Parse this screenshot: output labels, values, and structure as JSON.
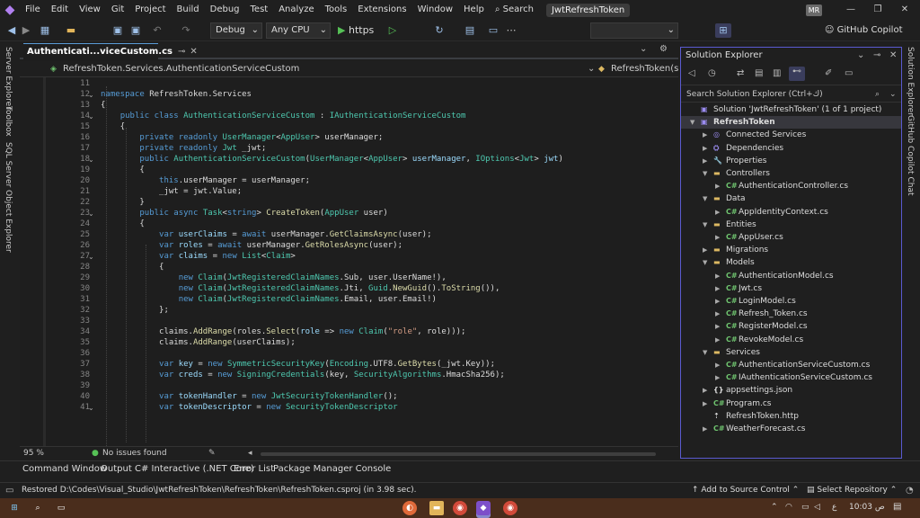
{
  "menubar": {
    "items": [
      "File",
      "Edit",
      "View",
      "Git",
      "Project",
      "Build",
      "Debug",
      "Test",
      "Analyze",
      "Tools",
      "Extensions",
      "Window",
      "Help"
    ],
    "search_label": "Search",
    "solution_title": "JwtRefreshToken",
    "avatar_initials": "MR"
  },
  "toolbar": {
    "config": "Debug",
    "platform": "Any CPU",
    "run_label": "https",
    "copilot_label": "GitHub Copilot"
  },
  "left_tabs": [
    "Server Explorer",
    "Toolbox",
    "SQL Server Object Explorer"
  ],
  "right_tabs": [
    "Solution Explorer",
    "GitHub Copilot Chat"
  ],
  "editor": {
    "tab_title": "Authenticati...viceCustom.cs",
    "nav_left": "RefreshToken.Services.AuthenticationServiceCustom",
    "nav_right": "RefreshToken(strin",
    "zoom": "95 %",
    "issues": "No issues found",
    "lines": [
      {
        "n": "11",
        "t": []
      },
      {
        "n": "12",
        "f": true,
        "t": [
          [
            "kw",
            "namespace "
          ],
          [
            "",
            "RefreshToken.Services"
          ]
        ]
      },
      {
        "n": "13",
        "t": [
          [
            "",
            "{"
          ]
        ]
      },
      {
        "n": "14",
        "f": true,
        "t": [
          [
            "",
            "    "
          ],
          [
            "kw",
            "public class "
          ],
          [
            "ty",
            "AuthenticationServiceCustom"
          ],
          [
            "",
            " : "
          ],
          [
            "ty",
            "IAuthenticationServiceCustom"
          ]
        ]
      },
      {
        "n": "15",
        "t": [
          [
            "",
            "    {"
          ]
        ]
      },
      {
        "n": "16",
        "t": [
          [
            "",
            "        "
          ],
          [
            "kw",
            "private readonly "
          ],
          [
            "ty",
            "UserManager"
          ],
          [
            "",
            "<"
          ],
          [
            "ty",
            "AppUser"
          ],
          [
            "",
            "> userManager;"
          ]
        ]
      },
      {
        "n": "17",
        "t": [
          [
            "",
            "        "
          ],
          [
            "kw",
            "private readonly "
          ],
          [
            "ty",
            "Jwt"
          ],
          [
            "",
            " _jwt;"
          ]
        ]
      },
      {
        "n": "18",
        "f": true,
        "t": [
          [
            "",
            "        "
          ],
          [
            "kw",
            "public "
          ],
          [
            "ty",
            "AuthenticationServiceCustom"
          ],
          [
            "",
            "("
          ],
          [
            "ty",
            "UserManager"
          ],
          [
            "",
            "<"
          ],
          [
            "ty",
            "AppUser"
          ],
          [
            "",
            "> "
          ],
          [
            "pr",
            "userManager"
          ],
          [
            "",
            ", "
          ],
          [
            "ty",
            "IOptions"
          ],
          [
            "",
            "<"
          ],
          [
            "ty",
            "Jwt"
          ],
          [
            "",
            "> "
          ],
          [
            "pr",
            "jwt"
          ],
          [
            "",
            ")"
          ]
        ]
      },
      {
        "n": "19",
        "t": [
          [
            "",
            "        {"
          ]
        ]
      },
      {
        "n": "20",
        "t": [
          [
            "",
            "            "
          ],
          [
            "kw",
            "this"
          ],
          [
            "",
            ".userManager = userManager;"
          ]
        ]
      },
      {
        "n": "21",
        "t": [
          [
            "",
            "            _jwt = jwt.Value;"
          ]
        ]
      },
      {
        "n": "22",
        "t": [
          [
            "",
            "        }"
          ]
        ]
      },
      {
        "n": "23",
        "f": true,
        "t": [
          [
            "",
            "        "
          ],
          [
            "kw",
            "public async "
          ],
          [
            "ty",
            "Task"
          ],
          [
            "",
            "<"
          ],
          [
            "kw",
            "string"
          ],
          [
            "",
            "> "
          ],
          [
            "mt",
            "CreateToken"
          ],
          [
            "",
            "("
          ],
          [
            "ty",
            "AppUser"
          ],
          [
            "",
            " user)"
          ]
        ]
      },
      {
        "n": "24",
        "t": [
          [
            "",
            "        {"
          ]
        ]
      },
      {
        "n": "25",
        "t": [
          [
            "",
            "            "
          ],
          [
            "kw",
            "var "
          ],
          [
            "pr",
            "userClaims"
          ],
          [
            "",
            " = "
          ],
          [
            "kw",
            "await "
          ],
          [
            "",
            "userManager."
          ],
          [
            "mt",
            "GetClaimsAsync"
          ],
          [
            "",
            "(user);"
          ]
        ]
      },
      {
        "n": "26",
        "t": [
          [
            "",
            "            "
          ],
          [
            "kw",
            "var "
          ],
          [
            "pr",
            "roles"
          ],
          [
            "",
            " = "
          ],
          [
            "kw",
            "await "
          ],
          [
            "",
            "userManager."
          ],
          [
            "mt",
            "GetRolesAsync"
          ],
          [
            "",
            "(user);"
          ]
        ]
      },
      {
        "n": "27",
        "f": true,
        "t": [
          [
            "",
            "            "
          ],
          [
            "kw",
            "var "
          ],
          [
            "pr",
            "claims"
          ],
          [
            "",
            " = "
          ],
          [
            "kw",
            "new "
          ],
          [
            "ty",
            "List"
          ],
          [
            "",
            "<"
          ],
          [
            "ty",
            "Claim"
          ],
          [
            "",
            ">"
          ]
        ]
      },
      {
        "n": "28",
        "t": [
          [
            "",
            "            {"
          ]
        ]
      },
      {
        "n": "29",
        "t": [
          [
            "",
            "                "
          ],
          [
            "kw",
            "new "
          ],
          [
            "ty",
            "Claim"
          ],
          [
            "",
            "("
          ],
          [
            "ty",
            "JwtRegisteredClaimNames"
          ],
          [
            "",
            ".Sub, user.UserName!),"
          ]
        ]
      },
      {
        "n": "30",
        "t": [
          [
            "",
            "                "
          ],
          [
            "kw",
            "new "
          ],
          [
            "ty",
            "Claim"
          ],
          [
            "",
            "("
          ],
          [
            "ty",
            "JwtRegisteredClaimNames"
          ],
          [
            "",
            ".Jti, "
          ],
          [
            "ty",
            "Guid"
          ],
          [
            "",
            "."
          ],
          [
            "mt",
            "NewGuid"
          ],
          [
            "",
            "()."
          ],
          [
            "mt",
            "ToString"
          ],
          [
            "",
            "()),"
          ]
        ]
      },
      {
        "n": "31",
        "t": [
          [
            "",
            "                "
          ],
          [
            "kw",
            "new "
          ],
          [
            "ty",
            "Claim"
          ],
          [
            "",
            "("
          ],
          [
            "ty",
            "JwtRegisteredClaimNames"
          ],
          [
            "",
            ".Email, user.Email!)"
          ]
        ]
      },
      {
        "n": "32",
        "t": [
          [
            "",
            "            };"
          ]
        ]
      },
      {
        "n": "33",
        "t": []
      },
      {
        "n": "34",
        "t": [
          [
            "",
            "            claims."
          ],
          [
            "mt",
            "AddRange"
          ],
          [
            "",
            "(roles."
          ],
          [
            "mt",
            "Select"
          ],
          [
            "",
            "("
          ],
          [
            "pr",
            "role"
          ],
          [
            "",
            " => "
          ],
          [
            "kw",
            "new "
          ],
          [
            "ty",
            "Claim"
          ],
          [
            "",
            "("
          ],
          [
            "st",
            "\"role\""
          ],
          [
            "",
            ", role)));"
          ]
        ]
      },
      {
        "n": "35",
        "t": [
          [
            "",
            "            claims."
          ],
          [
            "mt",
            "AddRange"
          ],
          [
            "",
            "(userClaims);"
          ]
        ]
      },
      {
        "n": "36",
        "t": []
      },
      {
        "n": "37",
        "t": [
          [
            "",
            "            "
          ],
          [
            "kw",
            "var "
          ],
          [
            "pr",
            "key"
          ],
          [
            "",
            " = "
          ],
          [
            "kw",
            "new "
          ],
          [
            "ty",
            "SymmetricSecurityKey"
          ],
          [
            "",
            "("
          ],
          [
            "ty",
            "Encoding"
          ],
          [
            "",
            ".UTF8."
          ],
          [
            "mt",
            "GetBytes"
          ],
          [
            "",
            "(_jwt.Key));"
          ]
        ]
      },
      {
        "n": "38",
        "t": [
          [
            "",
            "            "
          ],
          [
            "kw",
            "var "
          ],
          [
            "pr",
            "creds"
          ],
          [
            "",
            " = "
          ],
          [
            "kw",
            "new "
          ],
          [
            "ty",
            "SigningCredentials"
          ],
          [
            "",
            "(key, "
          ],
          [
            "ty",
            "SecurityAlgorithms"
          ],
          [
            "",
            ".HmacSha256);"
          ]
        ]
      },
      {
        "n": "39",
        "t": []
      },
      {
        "n": "40",
        "t": [
          [
            "",
            "            "
          ],
          [
            "kw",
            "var "
          ],
          [
            "pr",
            "tokenHandler"
          ],
          [
            "",
            " = "
          ],
          [
            "kw",
            "new "
          ],
          [
            "ty",
            "JwtSecurityTokenHandler"
          ],
          [
            "",
            "();"
          ]
        ]
      },
      {
        "n": "41",
        "f": true,
        "t": [
          [
            "",
            "            "
          ],
          [
            "kw",
            "var "
          ],
          [
            "pr",
            "tokenDescriptor"
          ],
          [
            "",
            " = "
          ],
          [
            "kw",
            "new "
          ],
          [
            "ty",
            "SecurityTokenDescriptor"
          ]
        ]
      }
    ]
  },
  "solution_explorer": {
    "title": "Solution Explorer",
    "search_placeholder": "Search Solution Explorer (Ctrl+ك)",
    "tree": [
      {
        "d": 0,
        "a": "",
        "i": "sln",
        "label": "Solution 'JwtRefreshToken' (1 of 1 project)"
      },
      {
        "d": 0,
        "a": "▼",
        "i": "proj",
        "label": "RefreshToken",
        "bold": true
      },
      {
        "d": 1,
        "a": "▶",
        "i": "svc",
        "label": "Connected Services"
      },
      {
        "d": 1,
        "a": "▶",
        "i": "dep",
        "label": "Dependencies"
      },
      {
        "d": 1,
        "a": "▶",
        "i": "prop",
        "label": "Properties"
      },
      {
        "d": 1,
        "a": "▼",
        "i": "folder",
        "label": "Controllers"
      },
      {
        "d": 2,
        "a": "▶",
        "i": "cs",
        "label": "AuthenticationController.cs"
      },
      {
        "d": 1,
        "a": "▼",
        "i": "folder",
        "label": "Data"
      },
      {
        "d": 2,
        "a": "▶",
        "i": "cs",
        "label": "AppIdentityContext.cs"
      },
      {
        "d": 1,
        "a": "▼",
        "i": "folder",
        "label": "Entities"
      },
      {
        "d": 2,
        "a": "▶",
        "i": "cs",
        "label": "AppUser.cs"
      },
      {
        "d": 1,
        "a": "▶",
        "i": "folder",
        "label": "Migrations"
      },
      {
        "d": 1,
        "a": "▼",
        "i": "folder",
        "label": "Models"
      },
      {
        "d": 2,
        "a": "▶",
        "i": "cs",
        "label": "AuthenticationModel.cs"
      },
      {
        "d": 2,
        "a": "▶",
        "i": "cs",
        "label": "Jwt.cs"
      },
      {
        "d": 2,
        "a": "▶",
        "i": "cs",
        "label": "LoginModel.cs"
      },
      {
        "d": 2,
        "a": "▶",
        "i": "cs",
        "label": "Refresh_Token.cs"
      },
      {
        "d": 2,
        "a": "▶",
        "i": "cs",
        "label": "RegisterModel.cs"
      },
      {
        "d": 2,
        "a": "▶",
        "i": "cs",
        "label": "RevokeModel.cs"
      },
      {
        "d": 1,
        "a": "▼",
        "i": "folder",
        "label": "Services"
      },
      {
        "d": 2,
        "a": "▶",
        "i": "cs",
        "label": "AuthenticationServiceCustom.cs"
      },
      {
        "d": 2,
        "a": "▶",
        "i": "cs",
        "label": "IAuthenticationServiceCustom.cs"
      },
      {
        "d": 1,
        "a": "▶",
        "i": "json",
        "label": "appsettings.json"
      },
      {
        "d": 1,
        "a": "▶",
        "i": "cs",
        "label": "Program.cs"
      },
      {
        "d": 1,
        "a": "",
        "i": "http",
        "label": "RefreshToken.http"
      },
      {
        "d": 1,
        "a": "▶",
        "i": "cs",
        "label": "WeatherForecast.cs"
      }
    ]
  },
  "bottom_tabs": [
    "Command Window",
    "Output",
    "C# Interactive (.NET Core)",
    "Error List",
    "Package Manager Console"
  ],
  "status": {
    "message": "Restored D:\\Codes\\Visual_Studio\\JwtRefreshToken\\RefreshToken\\RefreshToken.csproj (in 3.98 sec).",
    "source_control": "Add to Source Control",
    "repository": "Select Repository"
  },
  "taskbar": {
    "time": "10:03 ص",
    "lang": "ع"
  },
  "colors": {
    "accent": "#5a5ad0",
    "keyword": "#569cd6",
    "type": "#4ec9b0",
    "method": "#dcdcaa",
    "param": "#9cdcfe",
    "string": "#d69d85",
    "cs_icon": "#6fc36f",
    "folder_icon": "#dcb862"
  }
}
